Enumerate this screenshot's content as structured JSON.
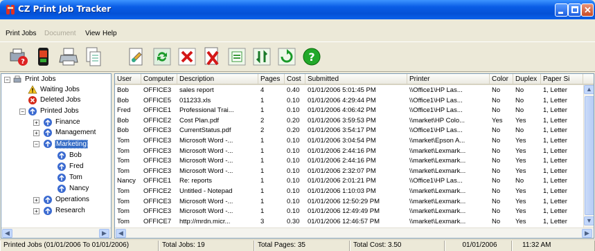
{
  "window": {
    "title": "CZ Print Job Tracker"
  },
  "menu": [
    {
      "label": "Print Jobs",
      "enabled": true
    },
    {
      "label": "Document",
      "enabled": false
    },
    {
      "label": "View",
      "enabled": true
    },
    {
      "label": "Help",
      "enabled": true
    }
  ],
  "toolbar_icons": [
    "help-printer-icon",
    "device-icon",
    "printer-icon",
    "copy-document-icon",
    "edit-document-icon",
    "refresh-icon",
    "delete-icon",
    "delete-document-icon",
    "export-icon",
    "sort-icon",
    "check-icon",
    "help-icon"
  ],
  "tree": {
    "root": "Print Jobs",
    "waiting": "Waiting Jobs",
    "deleted": "Deleted Jobs",
    "printed": "Printed Jobs",
    "finance": "Finance",
    "management": "Management",
    "marketing": "Marketing",
    "bob": "Bob",
    "fred": "Fred",
    "tom": "Tom",
    "nancy": "Nancy",
    "operations": "Operations",
    "research": "Research"
  },
  "columns": [
    "User",
    "Computer",
    "Description",
    "Pages",
    "Cost",
    "Submitted",
    "Printer",
    "Color",
    "Duplex",
    "Paper Si"
  ],
  "rows": [
    [
      "Bob",
      "OFFICE3",
      "sales report",
      "4",
      "0.40",
      "01/01/2006 5:01:45 PM",
      "\\\\Office1\\HP Las...",
      "No",
      "No",
      "1, Letter"
    ],
    [
      "Bob",
      "OFFICE5",
      "011233.xls",
      "1",
      "0.10",
      "01/01/2006 4:29:44 PM",
      "\\\\Office1\\HP Las...",
      "No",
      "No",
      "1, Letter"
    ],
    [
      "Fred",
      "OFFICE1",
      "Professional Trai...",
      "1",
      "0.10",
      "01/01/2006 4:06:42 PM",
      "\\\\Office1\\HP Las...",
      "No",
      "No",
      "1, Letter"
    ],
    [
      "Bob",
      "OFFICE2",
      "Cost Plan.pdf",
      "2",
      "0.20",
      "01/01/2006 3:59:53 PM",
      "\\\\market\\HP Colo...",
      "Yes",
      "Yes",
      "1, Letter"
    ],
    [
      "Bob",
      "OFFICE3",
      "CurrentStatus.pdf",
      "2",
      "0.20",
      "01/01/2006 3:54:17 PM",
      "\\\\Office1\\HP Las...",
      "No",
      "No",
      "1, Letter"
    ],
    [
      "Tom",
      "OFFICE3",
      "Microsoft Word -...",
      "1",
      "0.10",
      "01/01/2006 3:04:54 PM",
      "\\\\market\\Epson A...",
      "No",
      "Yes",
      "1, Letter"
    ],
    [
      "Tom",
      "OFFICE3",
      "Microsoft Word -...",
      "1",
      "0.10",
      "01/01/2006 2:44:16 PM",
      "\\\\market\\Lexmark...",
      "No",
      "Yes",
      "1, Letter"
    ],
    [
      "Tom",
      "OFFICE3",
      "Microsoft Word -...",
      "1",
      "0.10",
      "01/01/2006 2:44:16 PM",
      "\\\\market\\Lexmark...",
      "No",
      "Yes",
      "1, Letter"
    ],
    [
      "Tom",
      "OFFICE3",
      "Microsoft Word -...",
      "1",
      "0.10",
      "01/01/2006 2:32:07 PM",
      "\\\\market\\Lexmark...",
      "No",
      "Yes",
      "1, Letter"
    ],
    [
      "Nancy",
      "OFFICE1",
      "Re: reports",
      "1",
      "0.10",
      "01/01/2006 2:01:21 PM",
      "\\\\Office1\\HP Las...",
      "No",
      "No",
      "1, Letter"
    ],
    [
      "Tom",
      "OFFICE2",
      "Untitled - Notepad",
      "1",
      "0.10",
      "01/01/2006 1:10:03 PM",
      "\\\\market\\Lexmark...",
      "No",
      "Yes",
      "1, Letter"
    ],
    [
      "Tom",
      "OFFICE3",
      "Microsoft Word -...",
      "1",
      "0.10",
      "01/01/2006 12:50:29 PM",
      "\\\\market\\Lexmark...",
      "No",
      "Yes",
      "1, Letter"
    ],
    [
      "Tom",
      "OFFICE3",
      "Microsoft Word -...",
      "1",
      "0.10",
      "01/01/2006 12:49:49 PM",
      "\\\\market\\Lexmark...",
      "No",
      "Yes",
      "1, Letter"
    ],
    [
      "Tom",
      "OFFICE7",
      "http://mrdn.micr...",
      "3",
      "0.30",
      "01/01/2006 12:46:57 PM",
      "\\\\market\\Lexmark...",
      "No",
      "Yes",
      "1, Letter"
    ]
  ],
  "status": {
    "range": "Printed Jobs (01/01/2006 To 01/01/2006)",
    "total_jobs": "Total Jobs: 19",
    "total_pages": "Total Pages: 35",
    "total_cost": "Total Cost: 3.50",
    "date": "01/01/2006",
    "time": "11:32 AM"
  },
  "colors": {
    "title_bar": "#0a5de6",
    "selection": "#316ac5",
    "window_bg": "#ece9d8"
  }
}
